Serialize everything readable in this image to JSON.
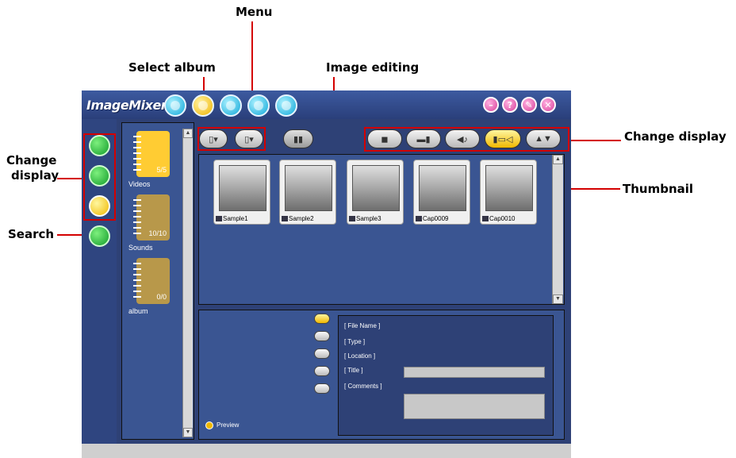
{
  "callouts": {
    "menu": "Menu",
    "select_album": "Select album",
    "image_editing": "Image editing",
    "change_display_right": "Change display",
    "change_display_left_1": "Change",
    "change_display_left_2": "display",
    "search": "Search",
    "thumbnail": "Thumbnail"
  },
  "app": {
    "logo": "ImageMixer",
    "top_icons": [
      "album-icon",
      "select-album-icon",
      "image-icon",
      "sound-icon",
      "export-icon"
    ],
    "window_controls": [
      "minimize-icon",
      "help-icon",
      "settings-icon",
      "close-icon"
    ]
  },
  "albums": [
    {
      "label": "Videos",
      "count": "5/5",
      "color": "#ffcc33"
    },
    {
      "label": "Sounds",
      "count": "10/10",
      "color": "#b8984a"
    },
    {
      "label": "album",
      "count": "0/0",
      "color": "#b8984a"
    }
  ],
  "thumbnails": [
    {
      "name": "Sample1"
    },
    {
      "name": "Sample2"
    },
    {
      "name": "Sample3"
    },
    {
      "name": "Cap0009"
    },
    {
      "name": "Cap0010"
    }
  ],
  "info": {
    "file_name": "[ File Name ]",
    "type": "[ Type ]",
    "location": "[ Location ]",
    "title": "[ Title ]",
    "comments": "[ Comments ]",
    "preview": "Preview"
  },
  "colors": {
    "callout_red": "#d40000",
    "app_bg": "#2e4176",
    "panel_bg": "#3a5592"
  }
}
